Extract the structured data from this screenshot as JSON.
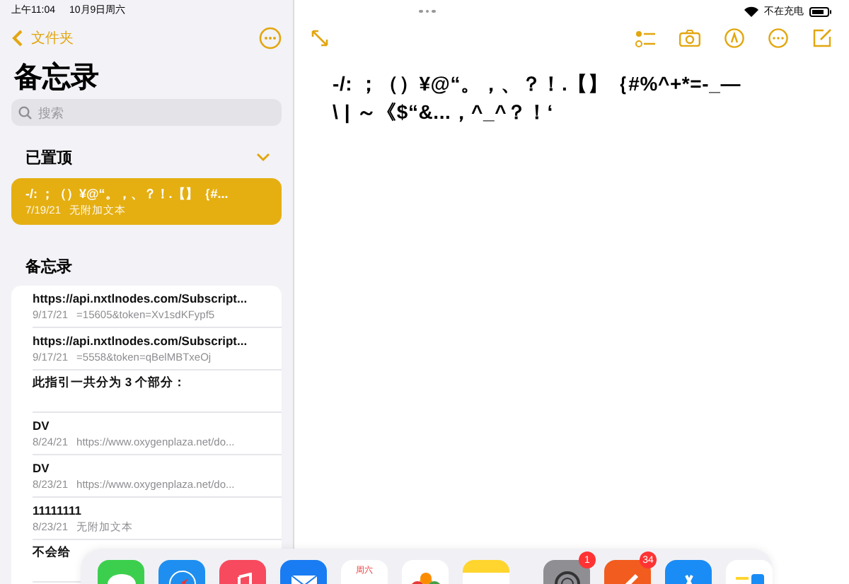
{
  "status_bar": {
    "time": "上午11:04",
    "date": "10月9日周六",
    "charging": "不在充电"
  },
  "sidebar": {
    "back_label": "文件夹",
    "title": "备忘录",
    "search": {
      "placeholder": "搜索"
    },
    "pinned": {
      "heading": "已置顶",
      "expanded": true,
      "notes": [
        {
          "title": "-/: ；（）¥@“。，、？！.【】｛#...",
          "date": "7/19/21",
          "preview": "无附加文本",
          "selected": true
        }
      ]
    },
    "notes_section": {
      "heading": "备忘录",
      "notes": [
        {
          "title": "https://api.nxtlnodes.com/Subscript...",
          "date": "9/17/21",
          "preview": "=15605&token=Xv1sdKFypf5",
          "selected": false
        },
        {
          "title": "https://api.nxtlnodes.com/Subscript...",
          "date": "9/17/21",
          "preview": "=5558&token=qBelMBTxeOj",
          "selected": false
        },
        {
          "title": "此指引一共分为 3 个部分：",
          "selected": false
        },
        {
          "title": "DV",
          "date": "8/24/21",
          "preview": "https://www.oxygenplaza.net/do...",
          "selected": false
        },
        {
          "title": "DV",
          "date": "8/23/21",
          "preview": "https://www.oxygenplaza.net/do...",
          "selected": false
        },
        {
          "title": "11111111",
          "date": "8/23/21",
          "preview": "无附加文本",
          "selected": false
        },
        {
          "title": "不会给",
          "selected": false
        }
      ]
    }
  },
  "editor": {
    "lines": [
      "-/: ；（）¥@“。，、？！.【】｛#%^+*=-_—",
      "\\ | ～《$“&...，^_^？！‘"
    ]
  },
  "dock": {
    "apps": [
      {
        "kind": "messages"
      },
      {
        "kind": "safari"
      },
      {
        "kind": "music"
      },
      {
        "kind": "mail"
      },
      {
        "kind": "calendar",
        "label": "周六"
      },
      {
        "kind": "photos"
      },
      {
        "kind": "notes"
      },
      {
        "kind": "separator"
      },
      {
        "kind": "settings",
        "badge": "1"
      },
      {
        "kind": "garageband",
        "badge": "34"
      },
      {
        "kind": "appstore"
      },
      {
        "kind": "folder"
      }
    ]
  }
}
